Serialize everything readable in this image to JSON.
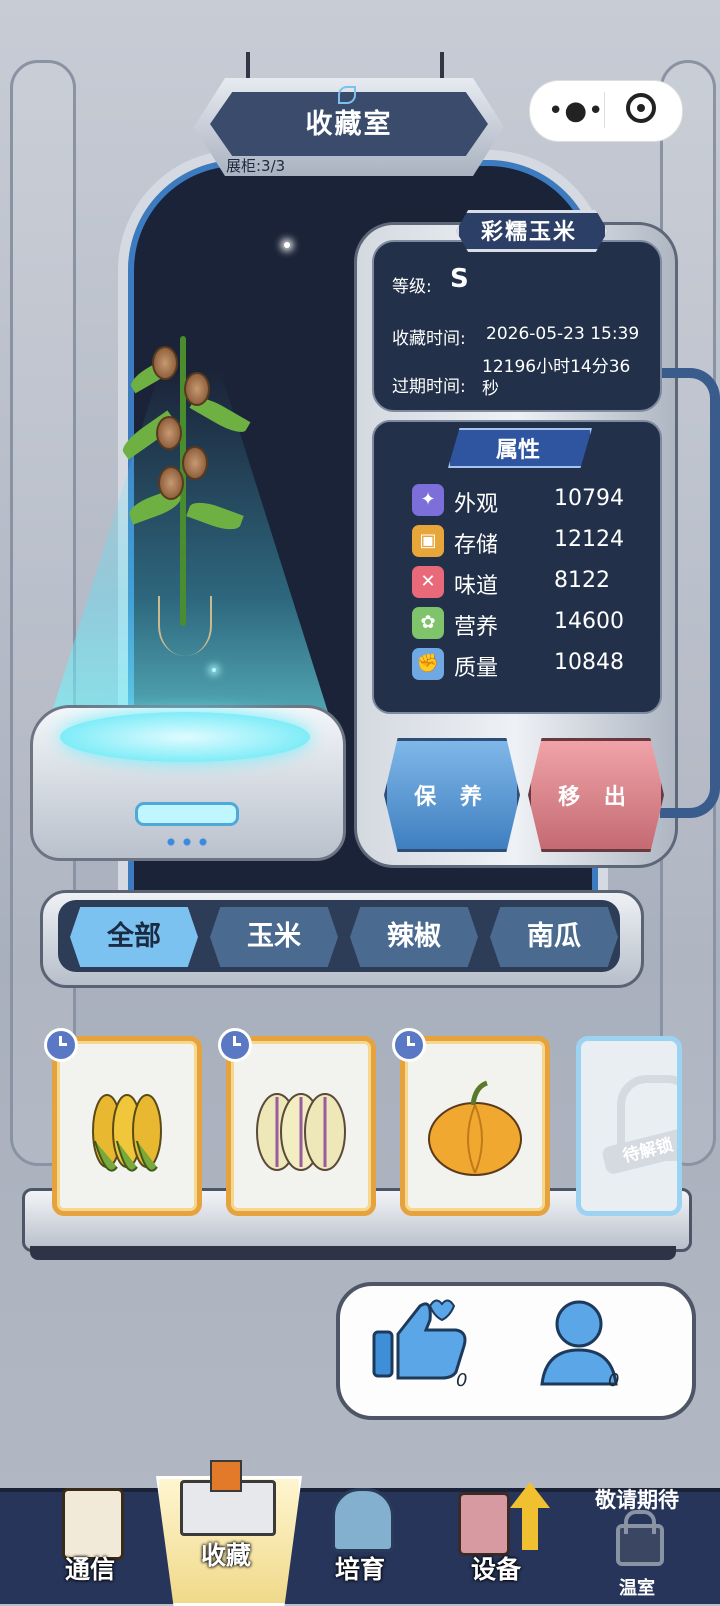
{
  "header": {
    "title": "收藏室",
    "cabinet": "展柜:3/3"
  },
  "capsule": {
    "menu_icon": "more-dots-icon",
    "close_icon": "target-icon"
  },
  "plant": {
    "name": "彩糯玉米",
    "grade_label": "等级:",
    "grade_value": "S",
    "collect_label": "收藏时间:",
    "collect_value": "2026-05-23 15:39",
    "expire_label": "过期时间:",
    "expire_value": "12196小时14分36秒"
  },
  "attributes": {
    "title": "属性",
    "items": [
      {
        "name": "外观",
        "value": "10794",
        "icon": "sparkle-icon",
        "color": "#7c6fd9"
      },
      {
        "name": "存储",
        "value": "12124",
        "icon": "box-icon",
        "color": "#e8a63a"
      },
      {
        "name": "味道",
        "value": "8122",
        "icon": "utensils-icon",
        "color": "#e86a7a"
      },
      {
        "name": "营养",
        "value": "14600",
        "icon": "nutrition-icon",
        "color": "#7fc46a"
      },
      {
        "name": "质量",
        "value": "10848",
        "icon": "muscle-icon",
        "color": "#6fa8e3"
      }
    ]
  },
  "actions": {
    "keep": "保 养",
    "remove": "移 出"
  },
  "tabs": [
    {
      "label": "全部",
      "active": true
    },
    {
      "label": "玉米",
      "active": false
    },
    {
      "label": "辣椒",
      "active": false
    },
    {
      "label": "南瓜",
      "active": false
    }
  ],
  "shelf": {
    "items": [
      {
        "name": "corn",
        "icon": "corn-icon"
      },
      {
        "name": "melon",
        "icon": "melon-icon"
      },
      {
        "name": "pumpkin",
        "icon": "pumpkin-icon"
      }
    ],
    "locked_label": "待解锁"
  },
  "social": {
    "like_count": "0",
    "visitor_count": "0"
  },
  "nav": {
    "items": [
      {
        "label": "通信"
      },
      {
        "label": "收藏"
      },
      {
        "label": "培育"
      },
      {
        "label": "设备"
      },
      {
        "label": "温室"
      }
    ],
    "coming_soon": "敬请期待"
  },
  "colors": {
    "accent": "#7cc2f0",
    "panel": "#223149",
    "keep": "#3f7fc0",
    "remove": "#c46a72"
  }
}
